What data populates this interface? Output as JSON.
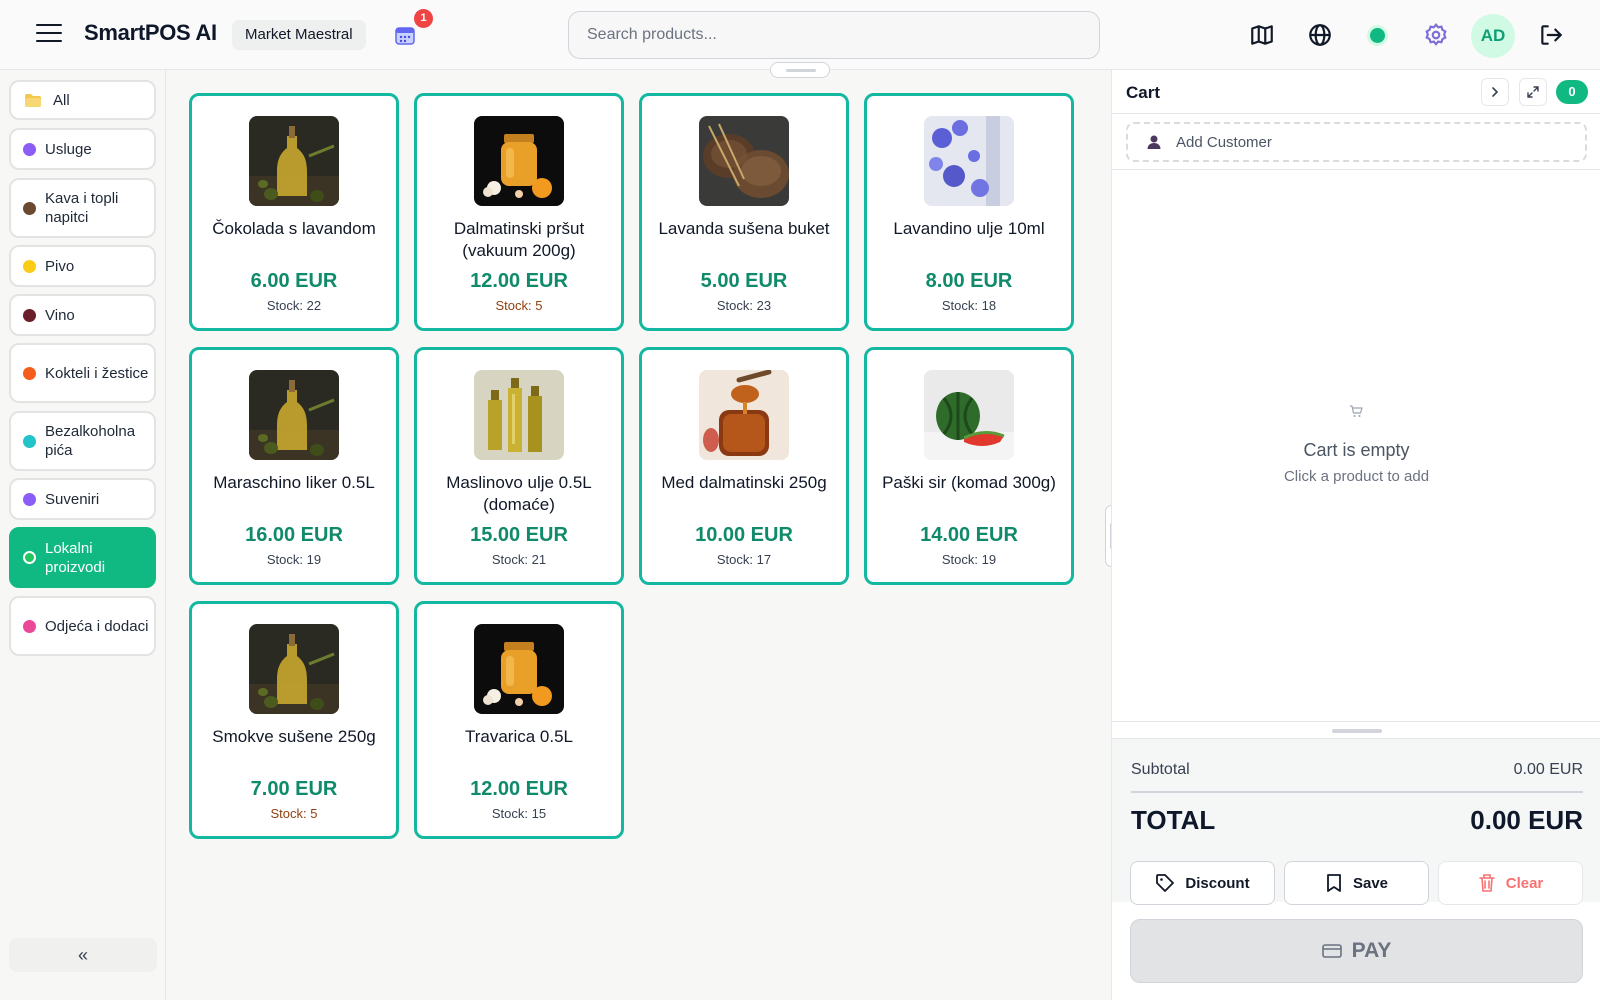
{
  "header": {
    "brand": "SmartPOS AI",
    "store": "Market Maestral",
    "calendar_badge": "1",
    "search_placeholder": "Search products...",
    "avatar_initials": "AD",
    "status_color": "#10b981"
  },
  "colors": {
    "accent": "#10b981",
    "card_border": "#14b8a0",
    "price": "#0f8a6a",
    "low_stock": "#92400e",
    "clear": "#f87171"
  },
  "categories": [
    {
      "label": "All",
      "icon": "folder-icon",
      "color": "#f2c94c"
    },
    {
      "label": "Usluge",
      "color": "#8b5cf6"
    },
    {
      "label": "Kava i topli napitci",
      "color": "#6b4a2f"
    },
    {
      "label": "Pivo",
      "color": "#facc15"
    },
    {
      "label": "Vino",
      "color": "#6b1f2a"
    },
    {
      "label": "Kokteli i žestice",
      "color": "#f45d1c"
    },
    {
      "label": "Bezalkoholna pića",
      "color": "#22c3c9"
    },
    {
      "label": "Suveniri",
      "color": "#8b5cf6"
    },
    {
      "label": "Lokalni proizvodi",
      "color": "#22c55e",
      "active": true
    },
    {
      "label": "Odjeća i dodaci",
      "color": "#ec4899"
    }
  ],
  "products": [
    {
      "name": "Čokolada s lavandom",
      "price": "6.00 EUR",
      "stock": "Stock: 22",
      "low": false,
      "image": "olive-oil"
    },
    {
      "name": "Dalmatinski pršut (vakuum 200g)",
      "price": "12.00 EUR",
      "stock": "Stock: 5",
      "low": true,
      "image": "honey-jar"
    },
    {
      "name": "Lavanda sušena buket",
      "price": "5.00 EUR",
      "stock": "Stock: 23",
      "low": false,
      "image": "bread"
    },
    {
      "name": "Lavandino ulje 10ml",
      "price": "8.00 EUR",
      "stock": "Stock: 18",
      "low": false,
      "image": "flowers"
    },
    {
      "name": "Maraschino liker 0.5L",
      "price": "16.00 EUR",
      "stock": "Stock: 19",
      "low": false,
      "image": "olive-oil"
    },
    {
      "name": "Maslinovo ulje 0.5L (domaće)",
      "price": "15.00 EUR",
      "stock": "Stock: 21",
      "low": false,
      "image": "oil-bottles"
    },
    {
      "name": "Med dalmatinski 250g",
      "price": "10.00 EUR",
      "stock": "Stock: 17",
      "low": false,
      "image": "honey-spoon"
    },
    {
      "name": "Paški sir (komad 300g)",
      "price": "14.00 EUR",
      "stock": "Stock: 19",
      "low": false,
      "image": "watermelon"
    },
    {
      "name": "Smokve sušene 250g",
      "price": "7.00 EUR",
      "stock": "Stock: 5",
      "low": true,
      "image": "olive-oil"
    },
    {
      "name": "Travarica 0.5L",
      "price": "12.00 EUR",
      "stock": "Stock: 15",
      "low": false,
      "image": "honey-jar"
    }
  ],
  "cart": {
    "title": "Cart",
    "count": "0",
    "add_customer": "Add Customer",
    "empty_title": "Cart is empty",
    "empty_sub": "Click a product to add",
    "subtotal_label": "Subtotal",
    "subtotal_value": "0.00 EUR",
    "total_label": "TOTAL",
    "total_value": "0.00 EUR",
    "discount_label": "Discount",
    "save_label": "Save",
    "clear_label": "Clear",
    "pay_label": "PAY"
  }
}
